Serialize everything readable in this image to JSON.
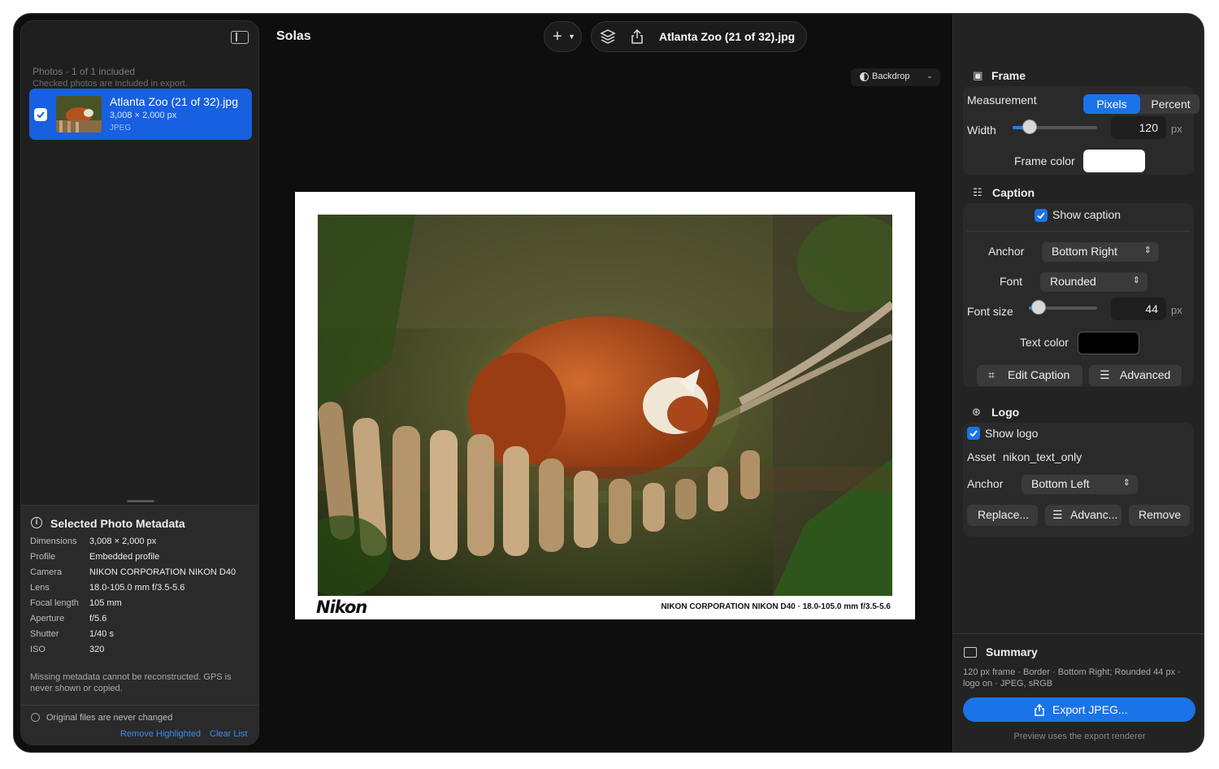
{
  "app": {
    "title": "Solas"
  },
  "toolbar": {
    "add_icon": "plus-icon",
    "document_title": "Atlanta Zoo (21 of 32).jpg"
  },
  "sidebar": {
    "header": "Photos · 1 of 1 included",
    "subheader": "Checked photos are included in export.",
    "photos": [
      {
        "name": "Atlanta Zoo (21 of 32).jpg",
        "size": "3,008 × 2,000 px",
        "type": "JPEG",
        "checked": true
      }
    ],
    "metadata_title": "Selected Photo Metadata",
    "metadata": [
      {
        "key": "Dimensions",
        "value": "3,008 × 2,000 px"
      },
      {
        "key": "Profile",
        "value": "Embedded profile"
      },
      {
        "key": "Camera",
        "value": "NIKON CORPORATION NIKON D40"
      },
      {
        "key": "Lens",
        "value": "18.0-105.0 mm f/3.5-5.6"
      },
      {
        "key": "Focal length",
        "value": "105 mm"
      },
      {
        "key": "Aperture",
        "value": "f/5.6"
      },
      {
        "key": "Shutter",
        "value": "1/40 s"
      },
      {
        "key": "ISO",
        "value": "320"
      }
    ],
    "metadata_note": "Missing metadata cannot be reconstructed. GPS is never shown or copied.",
    "original_note": "Original files are never changed",
    "remove_highlighted": "Remove Highlighted",
    "clear_list": "Clear List"
  },
  "canvas": {
    "backdrop_label": "Backdrop",
    "logo_text": "Nikon",
    "caption_text": "NIKON CORPORATION NIKON D40 · 18.0-105.0 mm f/3.5-5.6",
    "frame_color": "#ffffff"
  },
  "inspector": {
    "frame": {
      "title": "Frame",
      "measurement_label": "Measurement",
      "measurement_options": [
        "Pixels",
        "Percent"
      ],
      "measurement_selected": "Pixels",
      "width_label": "Width",
      "width_value": "120",
      "width_unit": "px",
      "width_fraction": 0.2,
      "frame_color_label": "Frame color",
      "frame_color": "#ffffff"
    },
    "caption": {
      "title": "Caption",
      "show_caption_label": "Show caption",
      "show_caption": true,
      "anchor_label": "Anchor",
      "anchor_value": "Bottom Right",
      "font_label": "Font",
      "font_value": "Rounded",
      "font_size_label": "Font size",
      "font_size_value": "44",
      "font_size_unit": "px",
      "font_size_fraction": 0.14,
      "text_color_label": "Text color",
      "text_color": "#000000",
      "edit_caption_label": "Edit Caption",
      "advanced_label": "Advanced"
    },
    "logo": {
      "title": "Logo",
      "show_logo_label": "Show logo",
      "show_logo": true,
      "asset_label": "Asset",
      "asset_value": "nikon_text_only",
      "anchor_label": "Anchor",
      "anchor_value": "Bottom Left",
      "replace_label": "Replace...",
      "advanced_label": "Advanc...",
      "remove_label": "Remove"
    },
    "summary": {
      "title": "Summary",
      "text": "120 px frame · Border · Bottom Right; Rounded 44 px · logo on · JPEG, sRGB",
      "export_label": "Export JPEG...",
      "preview_note": "Preview uses the export renderer"
    }
  },
  "colors": {
    "accent": "#1a73e8",
    "selection": "#1760e0",
    "link": "#3b8ef3"
  }
}
